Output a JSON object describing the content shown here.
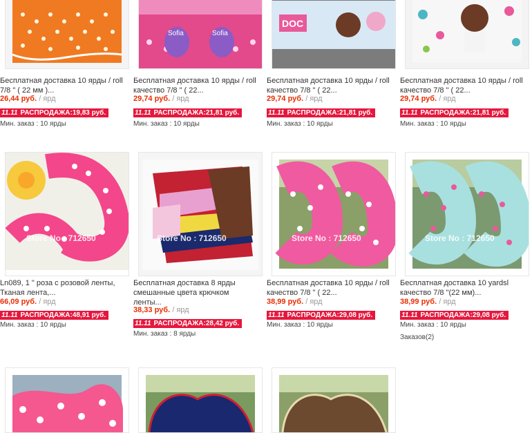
{
  "watermark": "Store No : 712650",
  "sale_icon": "11.11",
  "colors": {
    "price": "#e62e04",
    "sale_badge": "#e6173d"
  },
  "products": [
    {
      "title": "Бесплатная доставка 10 ярды / roll 7/8 \" ( 22 мм )...",
      "price": "26,44 руб.",
      "unit": "/ ярд",
      "sale_label": "РАСПРОДАЖА:",
      "sale_price": "19,83 руб.",
      "min_order": "Мин. заказ : 10 ярды"
    },
    {
      "title": "Бесплатная доставка 10 ярды / roll качество 7/8 \" ( 22...",
      "price": "29,74 руб.",
      "unit": "/ ярд",
      "sale_label": "РАСПРОДАЖА:",
      "sale_price": "21,81 руб.",
      "min_order": "Мин. заказ : 10 ярды"
    },
    {
      "title": "Бесплатная доставка 10 ярды / roll качество 7/8 \" ( 22...",
      "price": "29,74 руб.",
      "unit": "/ ярд",
      "sale_label": "РАСПРОДАЖА:",
      "sale_price": "21,81 руб.",
      "min_order": "Мин. заказ : 10 ярды"
    },
    {
      "title": "Бесплатная доставка 10 ярды / roll качество 7/8 \" ( 22...",
      "price": "29,74 руб.",
      "unit": "/ ярд",
      "sale_label": "РАСПРОДАЖА:",
      "sale_price": "21,81 руб.",
      "min_order": "Мин. заказ : 10 ярды"
    },
    {
      "title": "Ln089, 1 \" роза с розовой ленты, Тканая лента,...",
      "price": "66,09 руб.",
      "unit": "/ ярд",
      "sale_label": "РАСПРОДАЖА:",
      "sale_price": "48,91 руб.",
      "min_order": "Мин. заказ : 10 ярды"
    },
    {
      "title": "Бесплатная доставка 8 ярды смешанные цвета крючком ленты...",
      "price": "38,33 руб.",
      "unit": "/ ярд",
      "sale_label": "РАСПРОДАЖА:",
      "sale_price": "28,42 руб.",
      "min_order": "Мин. заказ : 8 ярды"
    },
    {
      "title": "Бесплатная доставка 10 ярды / roll качество 7/8 \" ( 22...",
      "price": "38,99 руб.",
      "unit": "/ ярд",
      "sale_label": "РАСПРОДАЖА:",
      "sale_price": "29,08 руб.",
      "min_order": "Мин. заказ : 10 ярды"
    },
    {
      "title": "Бесплатная доставка 10 yardsl качество 7/8 \"(22 мм)...",
      "price": "38,99 руб.",
      "unit": "/ ярд",
      "sale_label": "РАСПРОДАЖА:",
      "sale_price": "29,08 руб.",
      "min_order": "Мин. заказ : 10 ярды",
      "orders": "Заказов(2)"
    }
  ]
}
